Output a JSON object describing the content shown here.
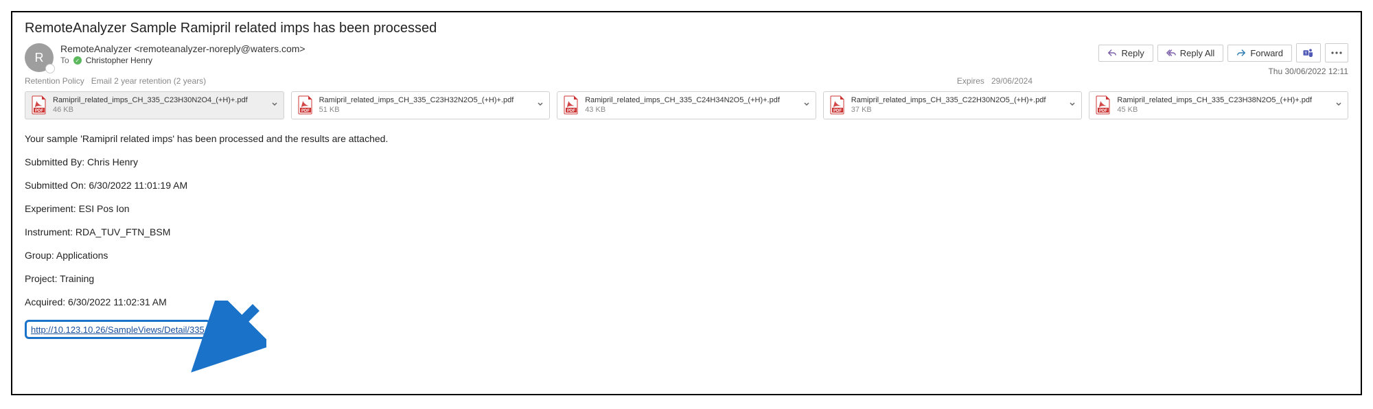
{
  "subject": "RemoteAnalyzer Sample Ramipril related imps has been processed",
  "from": "RemoteAnalyzer <remoteanalyzer-noreply@waters.com>",
  "to_label": "To",
  "to_name": "Christopher Henry",
  "avatar_initial": "R",
  "actions": {
    "reply": "Reply",
    "reply_all": "Reply All",
    "forward": "Forward"
  },
  "timestamp": "Thu 30/06/2022 12:11",
  "retention": {
    "label": "Retention Policy",
    "value": "Email 2 year retention (2 years)",
    "expires_label": "Expires",
    "expires_value": "29/06/2024"
  },
  "attachments": [
    {
      "name": "Ramipril_related_imps_CH_335_C23H30N2O4_(+H)+.pdf",
      "size": "46 KB",
      "selected": true
    },
    {
      "name": "Ramipril_related_imps_CH_335_C23H32N2O5_(+H)+.pdf",
      "size": "51 KB",
      "selected": false
    },
    {
      "name": "Ramipril_related_imps_CH_335_C24H34N2O5_(+H)+.pdf",
      "size": "43 KB",
      "selected": false
    },
    {
      "name": "Ramipril_related_imps_CH_335_C22H30N2O5_(+H)+.pdf",
      "size": "37 KB",
      "selected": false
    },
    {
      "name": "Ramipril_related_imps_CH_335_C23H38N2O5_(+H)+.pdf",
      "size": "45 KB",
      "selected": false
    }
  ],
  "body": {
    "line1": "Your sample 'Ramipril related imps' has been processed and the results are attached.",
    "line2": "Submitted By: Chris Henry",
    "line3": "Submitted On: 6/30/2022 11:01:19 AM",
    "line4": "Experiment: ESI Pos Ion",
    "line5": "Instrument: RDA_TUV_FTN_BSM",
    "line6": "Group: Applications",
    "line7": "Project: Training",
    "line8": "Acquired: 6/30/2022 11:02:31 AM",
    "link": "http://10.123.10.26/SampleViews/Detail/335"
  }
}
